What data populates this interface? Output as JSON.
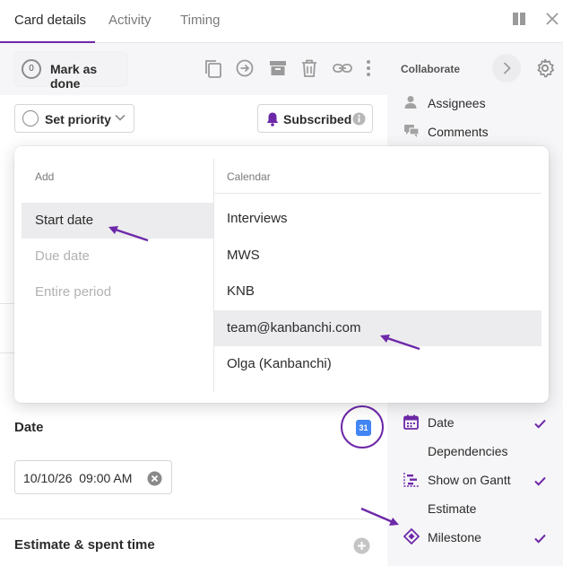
{
  "tabs": [
    {
      "label": "Card details",
      "active": true
    },
    {
      "label": "Activity",
      "active": false
    },
    {
      "label": "Timing",
      "active": false
    }
  ],
  "window_icons": [
    "split-view-icon",
    "close-icon"
  ],
  "actions": {
    "mark_done_count": "0",
    "mark_done_label": "Mark as done",
    "toolbar_icons": [
      "copy-icon",
      "move-icon",
      "archive-icon",
      "delete-icon",
      "link-icon",
      "more-icon"
    ]
  },
  "priority": {
    "label": "Set priority"
  },
  "subscribed": {
    "label": "Subscribed"
  },
  "date_section": {
    "title": "Date",
    "calendar_badge": "31",
    "value": "10/10/26  09:00 AM"
  },
  "estimate_section": {
    "title": "Estimate & spent time"
  },
  "sidebar": {
    "collaborate_label": "Collaborate",
    "items_top": [
      {
        "label": "Assignees",
        "icon": "person-icon"
      },
      {
        "label": "Comments",
        "icon": "comments-icon"
      }
    ],
    "items_bottom": [
      {
        "label": "Date",
        "icon": "calendar-icon",
        "checked": true
      },
      {
        "label": "Dependencies",
        "icon": "",
        "checked": false
      },
      {
        "label": "Show on Gantt",
        "icon": "gantt-icon",
        "checked": true
      },
      {
        "label": "Estimate",
        "icon": "",
        "checked": false
      },
      {
        "label": "Milestone",
        "icon": "milestone-icon",
        "checked": true
      }
    ]
  },
  "popup": {
    "add_header": "Add",
    "calendar_header": "Calendar",
    "add_options": [
      {
        "label": "Start date",
        "selected": true,
        "disabled": false
      },
      {
        "label": "Due date",
        "selected": false,
        "disabled": true
      },
      {
        "label": "Entire period",
        "selected": false,
        "disabled": true
      }
    ],
    "calendar_options": [
      {
        "label": "Interviews",
        "selected": false
      },
      {
        "label": "MWS",
        "selected": false
      },
      {
        "label": "KNB",
        "selected": false
      },
      {
        "label": "team@kanbanchi.com",
        "selected": true
      },
      {
        "label": "Olga (Kanbanchi)",
        "selected": false
      }
    ]
  },
  "colors": {
    "accent": "#6d28a8",
    "check": "#6d28a8",
    "google_calendar": "#4285f4"
  }
}
